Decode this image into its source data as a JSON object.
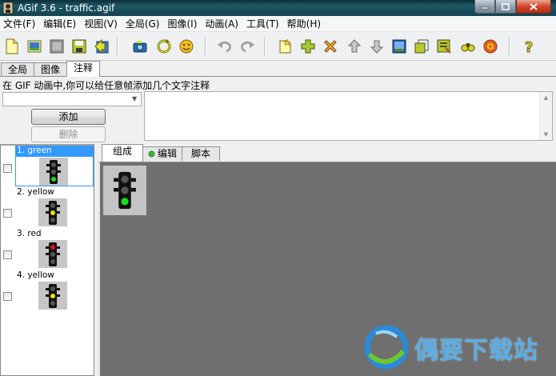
{
  "window": {
    "title": "AGif 3.6 - traffic.agif"
  },
  "menu": [
    "文件(F)",
    "编辑(E)",
    "视图(V)",
    "全局(G)",
    "图像(I)",
    "动画(A)",
    "工具(T)",
    "帮助(H)"
  ],
  "toolbar": {
    "icons": [
      "new-file-icon",
      "open-icon",
      "film-icon",
      "save-icon",
      "export-icon",
      "camera-icon",
      "refresh-icon",
      "smiley-icon",
      "undo-icon",
      "redo-icon",
      "new-frame-icon",
      "add-icon",
      "delete-icon",
      "move-up-icon",
      "move-down-icon",
      "image-edit-icon",
      "copy-frame-icon",
      "properties-icon",
      "binoculars-icon",
      "palette-icon",
      "help-icon"
    ]
  },
  "top_tabs": [
    {
      "label": "全局",
      "active": false
    },
    {
      "label": "图像",
      "active": false
    },
    {
      "label": "注释",
      "active": true
    }
  ],
  "comment_panel": {
    "hint": "在 GIF 动画中,你可以给任意帧添加几个文字注释",
    "combo_value": "",
    "add_label": "添加",
    "delete_label": "删除"
  },
  "frames": [
    {
      "label": "1. green",
      "light": "green",
      "selected": true
    },
    {
      "label": "2. yellow",
      "light": "yellow",
      "selected": false
    },
    {
      "label": "3. red",
      "light": "red",
      "selected": false
    },
    {
      "label": "4. yellow",
      "light": "yellow",
      "selected": false
    }
  ],
  "sub_tabs": [
    {
      "label": "组成",
      "active": true
    },
    {
      "label": "编辑",
      "active": false
    },
    {
      "label": "脚本",
      "active": false
    }
  ],
  "watermark": {
    "text": "偶要下载站"
  },
  "colors": {
    "red": "#e01010",
    "yellow": "#f0e000",
    "green": "#18e018",
    "off": "#555555",
    "canvas": "#6f6f6f",
    "selection": "#3399ff"
  }
}
